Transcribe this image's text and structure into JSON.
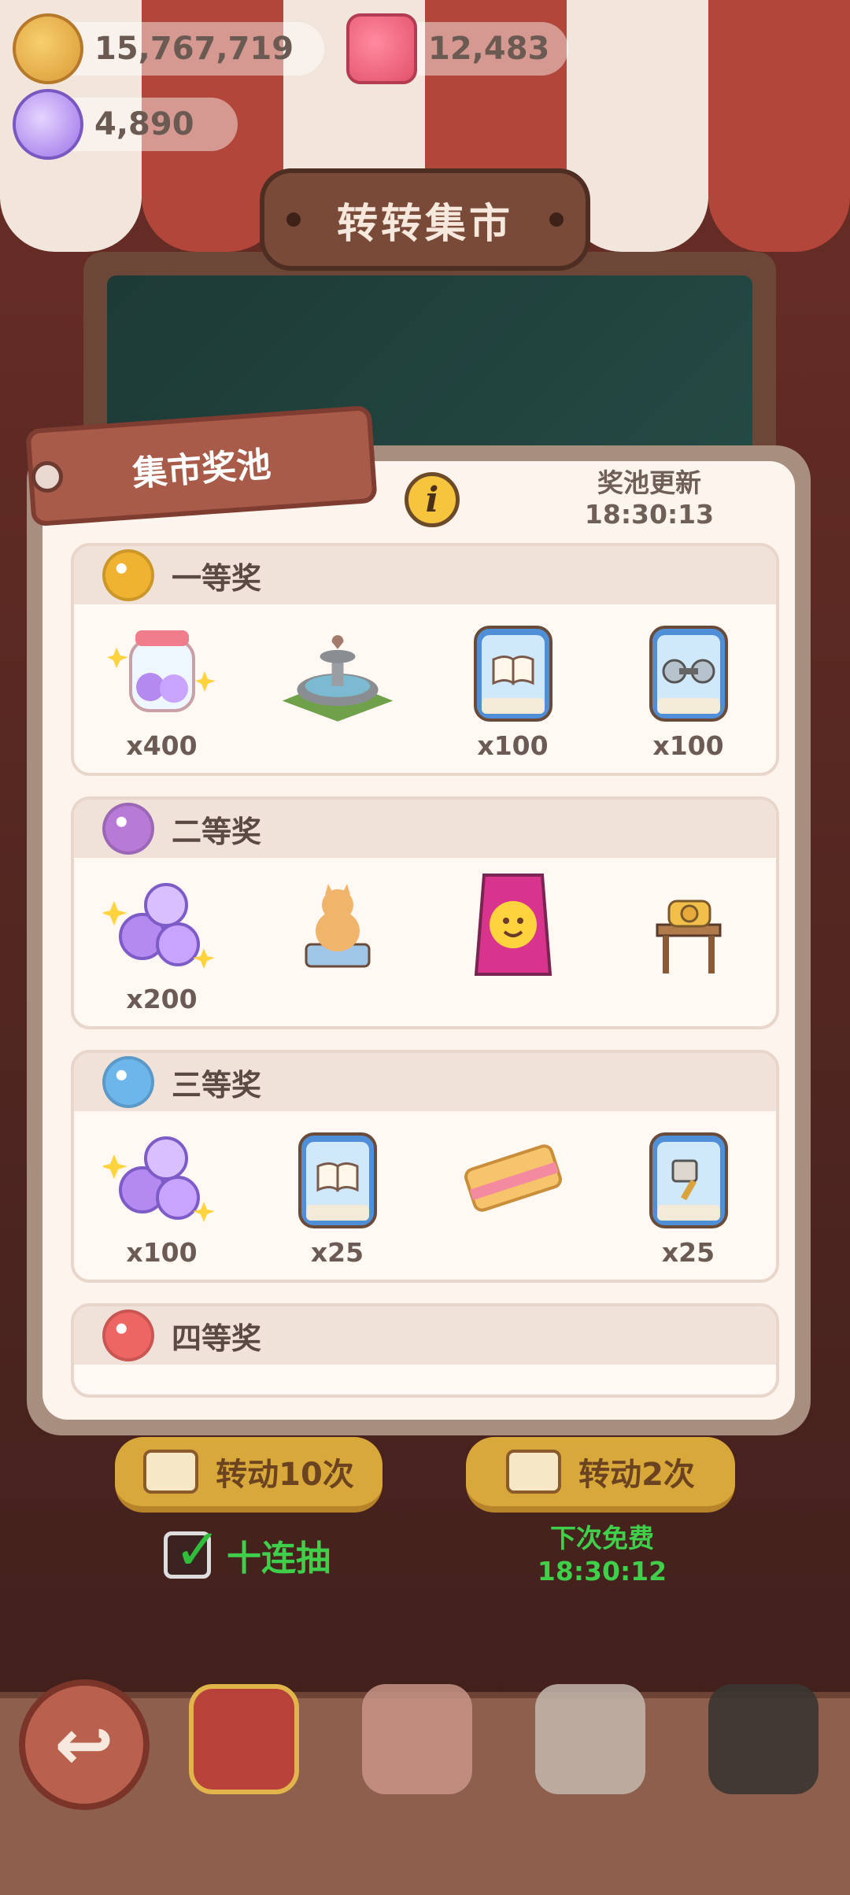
{
  "currencies": {
    "cookies": "15,767,719",
    "jelly": "12,483",
    "candy": "4,890"
  },
  "market_title": "转转集市",
  "pool": {
    "tag_title": "集市奖池",
    "refresh_label": "奖池更新",
    "refresh_time": "18:30:13",
    "tiers": [
      {
        "title": "一等奖",
        "color": "#f0b231",
        "items": [
          {
            "icon": "candy-jar-icon",
            "qty": "x400"
          },
          {
            "icon": "fountain-icon",
            "qty": ""
          },
          {
            "icon": "book-card-icon",
            "qty": "x100"
          },
          {
            "icon": "dumbbell-card-icon",
            "qty": "x100"
          }
        ]
      },
      {
        "title": "二等奖",
        "color": "#b77ad6",
        "items": [
          {
            "icon": "candies-icon",
            "qty": "x200"
          },
          {
            "icon": "cat-statue-icon",
            "qty": ""
          },
          {
            "icon": "snack-bag-icon",
            "qty": ""
          },
          {
            "icon": "telephone-table-icon",
            "qty": ""
          }
        ]
      },
      {
        "title": "三等奖",
        "color": "#6cb6ec",
        "items": [
          {
            "icon": "candies-icon",
            "qty": "x100"
          },
          {
            "icon": "book-card-icon",
            "qty": "x25"
          },
          {
            "icon": "biscuit-icon",
            "qty": ""
          },
          {
            "icon": "spatula-card-icon",
            "qty": "x25"
          }
        ]
      },
      {
        "title": "四等奖",
        "color": "#ee6663",
        "items": []
      }
    ]
  },
  "buttons": {
    "spin10": "转动10次",
    "spin2": "转动2次",
    "ten_draw_label": "十连抽",
    "ten_draw_checked": true,
    "next_free_label": "下次免费",
    "next_free_time": "18:30:12"
  },
  "nav": {
    "back_icon": "back-arrow-icon",
    "items": [
      "lion-dance-icon",
      "rabbit-icon",
      "house-icon",
      "machine-icon"
    ]
  }
}
